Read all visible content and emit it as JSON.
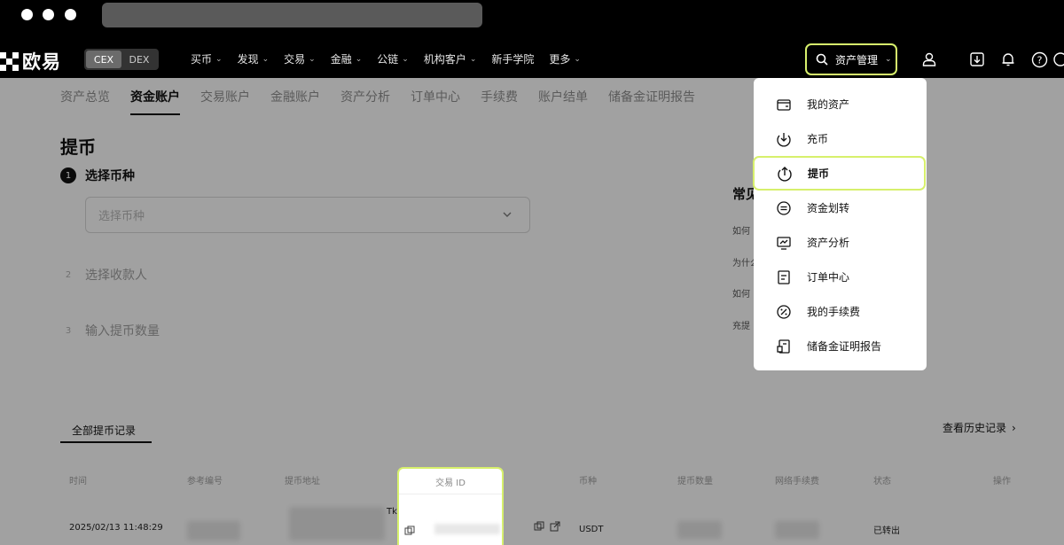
{
  "nav": {
    "logo_text": "欧易",
    "segments": [
      "CEX",
      "DEX"
    ],
    "menu": [
      {
        "label": "买币",
        "chev": true
      },
      {
        "label": "发现",
        "chev": true
      },
      {
        "label": "交易",
        "chev": true
      },
      {
        "label": "金融",
        "chev": true
      },
      {
        "label": "公链",
        "chev": true
      },
      {
        "label": "机构客户",
        "chev": true
      },
      {
        "label": "新手学院",
        "chev": false
      },
      {
        "label": "更多",
        "chev": true
      }
    ],
    "asset_button": "资产管理"
  },
  "tabs": [
    "资产总览",
    "资金账户",
    "交易账户",
    "金融账户",
    "资产分析",
    "订单中心",
    "手续费",
    "账户结单",
    "储备金证明报告"
  ],
  "active_tab": "资金账户",
  "page": {
    "title": "提币",
    "steps": [
      {
        "num": "1",
        "label": "选择币种"
      },
      {
        "num": "2",
        "label": "选择收款人"
      },
      {
        "num": "3",
        "label": "输入提币数量"
      }
    ],
    "select_placeholder": "选择币种"
  },
  "faq": {
    "title": "常见",
    "items": [
      "如何",
      "为什么",
      "如何",
      "充提"
    ]
  },
  "records": {
    "tab_label": "全部提币记录",
    "history_link": "查看历史记录",
    "columns": [
      "时间",
      "参考编号",
      "提币地址",
      "交易 ID",
      "币种",
      "提币数量",
      "网络手续费",
      "状态",
      "操作"
    ],
    "row": {
      "time": "2025/02/13 11:48:29",
      "address_fragment": "Tk",
      "coin": "USDT",
      "status": "已转出"
    }
  },
  "dropdown": {
    "items": [
      {
        "label": "我的资产",
        "icon": "wallet-icon"
      },
      {
        "label": "充币",
        "icon": "deposit-icon"
      },
      {
        "label": "提币",
        "icon": "withdraw-icon"
      },
      {
        "label": "资金划转",
        "icon": "transfer-icon"
      },
      {
        "label": "资产分析",
        "icon": "analysis-icon"
      },
      {
        "label": "订单中心",
        "icon": "order-icon"
      },
      {
        "label": "我的手续费",
        "icon": "fee-icon"
      },
      {
        "label": "储备金证明报告",
        "icon": "report-icon"
      }
    ],
    "highlighted": "提币"
  },
  "colors": {
    "highlight": "#d7f06c",
    "nav_bg": "#000000"
  }
}
